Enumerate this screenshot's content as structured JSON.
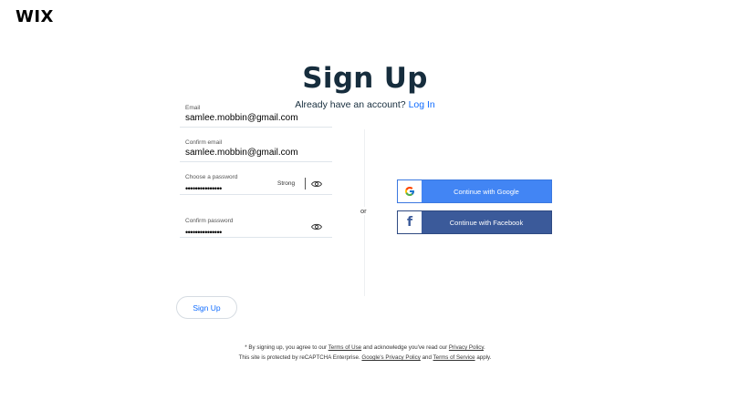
{
  "brand": {
    "logo_text": "WIX"
  },
  "header": {
    "title": "Sign Up",
    "subtitle_prefix": "Already have an account? ",
    "login_link": "Log In"
  },
  "form": {
    "email": {
      "label": "Email",
      "value": "samlee.mobbin@gmail.com"
    },
    "confirm_email": {
      "label": "Confirm email",
      "value": "samlee.mobbin@gmail.com"
    },
    "password": {
      "label": "Choose a password",
      "value": "•••••••••••••••",
      "strength": "Strong",
      "eye_icon": "eye-icon"
    },
    "confirm_password": {
      "label": "Confirm password",
      "value": "•••••••••••••••",
      "eye_icon": "eye-icon"
    }
  },
  "divider_text": "or",
  "social": {
    "google": {
      "label": "Continue with Google",
      "icon": "google-icon",
      "color": "#4285f4"
    },
    "facebook": {
      "label": "Continue with Facebook",
      "icon": "facebook-icon",
      "color": "#3b5a9a"
    }
  },
  "signup_button": {
    "label": "Sign Up",
    "color": "#116dff"
  },
  "legal": {
    "line1_prefix": "* By signing up, you agree to our ",
    "terms_of_use": "Terms of Use",
    "line1_middle": " and acknowledge you've read our ",
    "privacy_policy": "Privacy Policy",
    "line1_suffix": ".",
    "line2_prefix": "This site is protected by reCAPTCHA Enterprise. ",
    "google_privacy": "Google's Privacy Policy",
    "line2_middle": " and ",
    "terms_of_service": "Terms of Service",
    "line2_suffix": " apply."
  }
}
